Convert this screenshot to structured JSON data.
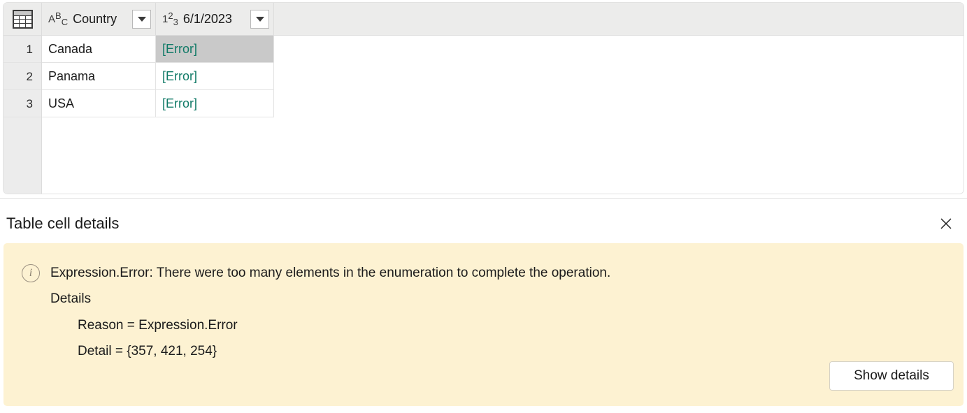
{
  "grid": {
    "corner_icon": "table-grid-icon",
    "columns": [
      {
        "type_icon": "abc-text-type-icon",
        "type_glyph": [
          "A",
          "B",
          "C"
        ],
        "title": "Country",
        "filter_icon": "filter-dropdown-icon"
      },
      {
        "type_icon": "123-number-type-icon",
        "type_glyph": [
          "1",
          "2",
          "3"
        ],
        "title": "6/1/2023",
        "filter_icon": "filter-dropdown-icon"
      }
    ],
    "rows": [
      {
        "number": "1",
        "country": "Canada",
        "value": "[Error]",
        "selected": true
      },
      {
        "number": "2",
        "country": "Panama",
        "value": "[Error]",
        "selected": false
      },
      {
        "number": "3",
        "country": "USA",
        "value": "[Error]",
        "selected": false
      }
    ]
  },
  "details": {
    "title": "Table cell details",
    "close_icon": "close-icon",
    "banner": {
      "info_icon": "info-circle-icon",
      "info_glyph": "i",
      "message": "Expression.Error: There were too many elements in the enumeration to complete the operation.",
      "details_label": "Details",
      "lines": [
        "Reason = Expression.Error",
        "Detail = {357, 421, 254}"
      ],
      "button_label": "Show details"
    }
  },
  "colors": {
    "error_text": "#107a67",
    "banner_bg": "#fdf2d2",
    "selected_cell": "#c9c9c9",
    "header_bg": "#ececeb"
  }
}
